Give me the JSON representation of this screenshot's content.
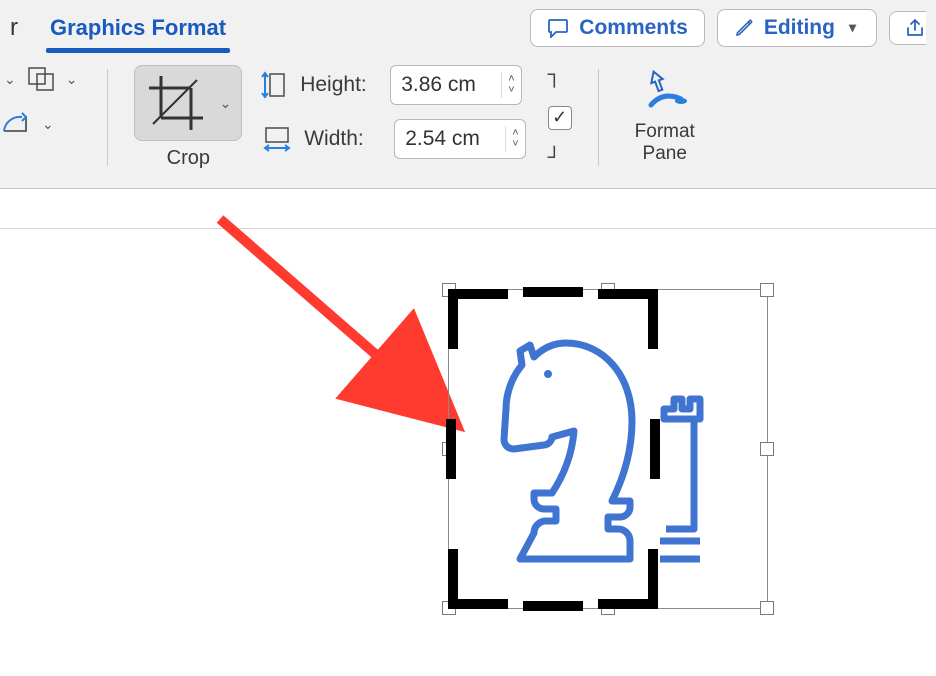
{
  "tabs": {
    "partial_left_letter": "r",
    "active": "Graphics Format"
  },
  "header_buttons": {
    "comments": "Comments",
    "editing": "Editing"
  },
  "tools": {
    "crop_label": "Crop",
    "height_label": "Height:",
    "width_label": "Width:",
    "height_value": "3.86 cm",
    "width_value": "2.54 cm",
    "format_pane_line1": "Format",
    "format_pane_line2": "Pane",
    "lock_aspect_checked": "✓"
  },
  "annotation": {
    "arrow_from": "Crop button",
    "arrow_to": "Cropped image on canvas"
  },
  "canvas": {
    "image_description": "Blue outline chess knight piece; a second partially-visible rook piece at right edge inside the original image bounds but outside the crop frame"
  }
}
